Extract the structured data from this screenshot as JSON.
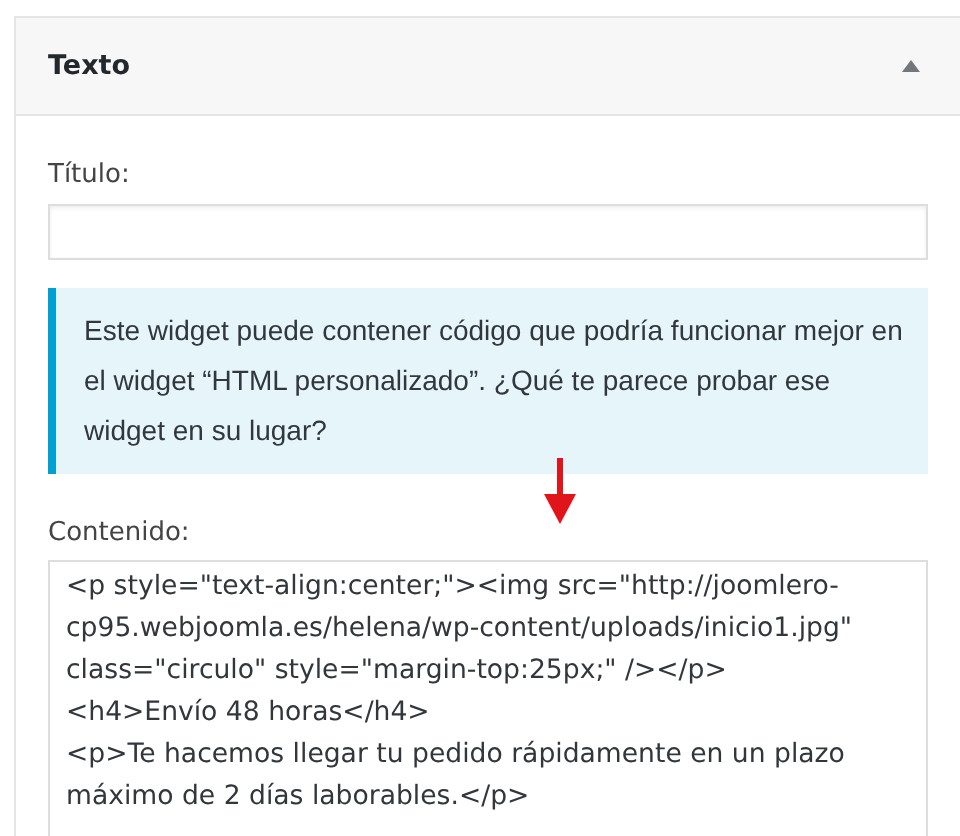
{
  "widget": {
    "title": "Texto",
    "expanded": true
  },
  "title_field": {
    "label": "Título:"
  },
  "notice": "Este widget puede contener código que podría funcionar mejor en el widget “HTML personalizado”. ¿Qué te parece probar ese widget en su lugar?",
  "content_field": {
    "label": "Contenido:",
    "value": "<p style=\"text-align:center;\"><img src=\"http://joomlero-cp95.webjoomla.es/helena/wp-content/uploads/inicio1.jpg\" class=\"circulo\" style=\"margin-top:25px;\" /></p>\n<h4>Envío 48 horas</h4>\n<p>Te hacemos llegar tu pedido rápidamente en un plazo máximo de 2 días laborables.</p>"
  }
}
